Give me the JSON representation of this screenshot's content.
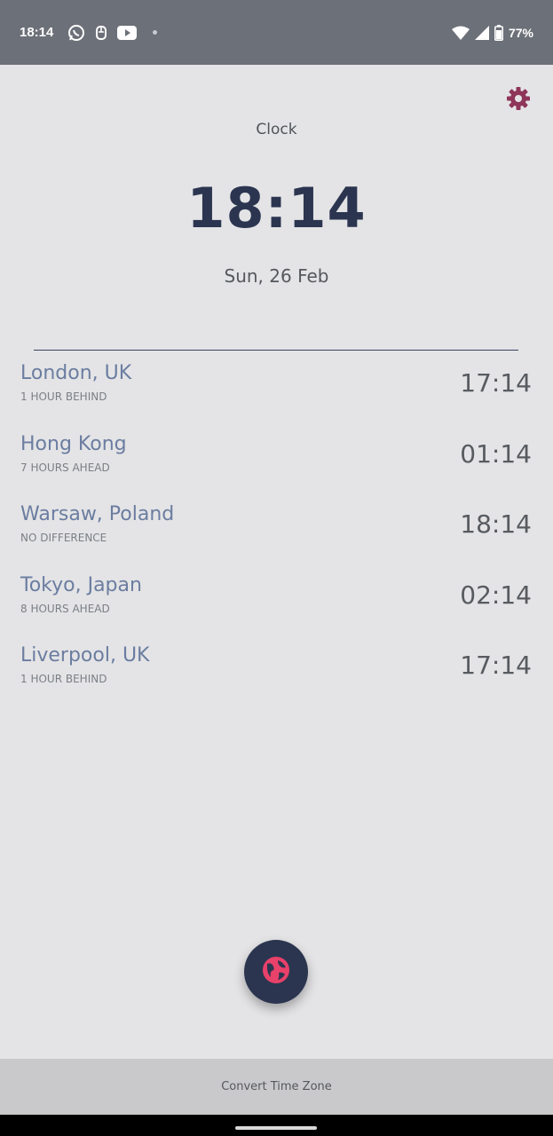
{
  "status_bar": {
    "time": "18:14",
    "battery": "77%",
    "icons": [
      "whatsapp-icon",
      "notification-icon",
      "youtube-icon",
      "more-dot-icon",
      "wifi-icon",
      "signal-icon",
      "battery-icon"
    ]
  },
  "header": {
    "title": "Clock",
    "settings_icon": "gear-icon",
    "accent_color": "#8e3559"
  },
  "clock": {
    "time": "18:14",
    "date": "Sun, 26 Feb",
    "color": "#2b3550"
  },
  "zones": [
    {
      "name": "London, UK",
      "difference": "1 HOUR BEHIND",
      "time": "17:14"
    },
    {
      "name": "Hong Kong",
      "difference": "7 HOURS AHEAD",
      "time": "01:14"
    },
    {
      "name": "Warsaw, Poland",
      "difference": "NO DIFFERENCE",
      "time": "18:14"
    },
    {
      "name": "Tokyo, Japan",
      "difference": "8 HOURS AHEAD",
      "time": "02:14"
    },
    {
      "name": "Liverpool, UK",
      "difference": "1 HOUR BEHIND",
      "time": "17:14"
    }
  ],
  "fab": {
    "icon": "globe-icon",
    "background": "#2b3550",
    "icon_color": "#e8416a"
  },
  "bottom_bar": {
    "label": "Convert Time Zone"
  }
}
